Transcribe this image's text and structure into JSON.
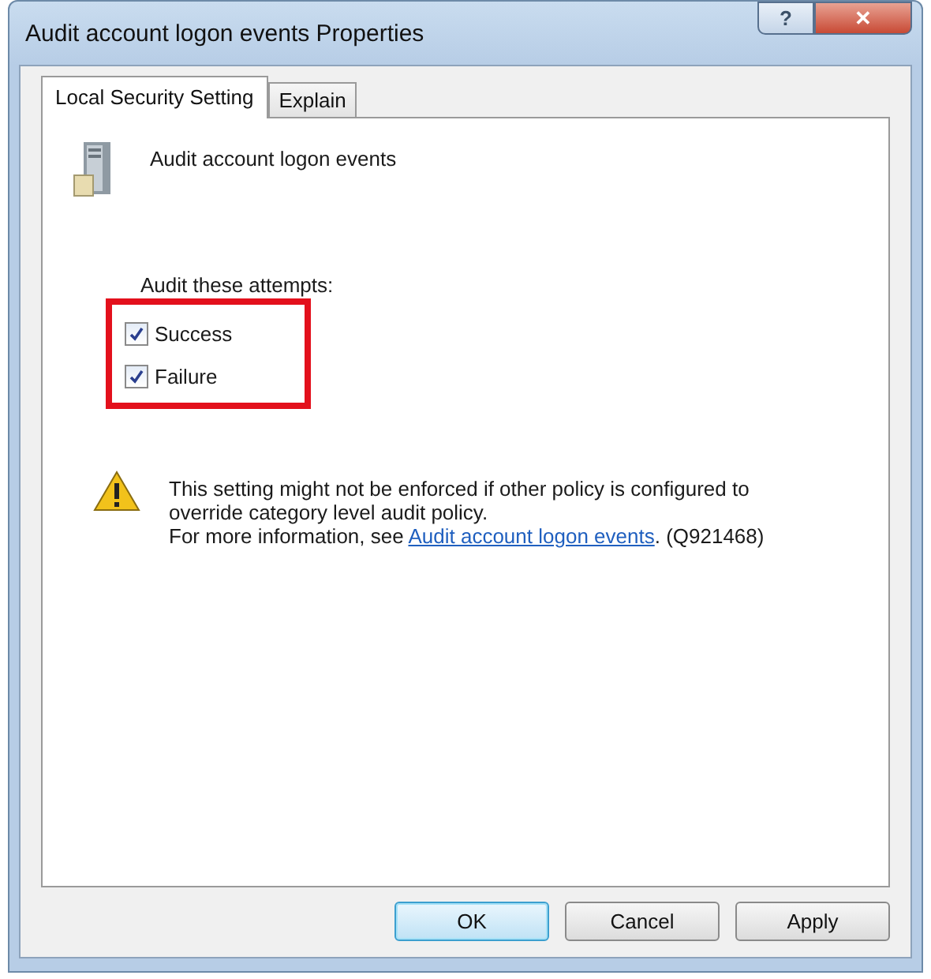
{
  "window": {
    "title": "Audit account logon events Properties",
    "title_buttons": [
      "?",
      "✕"
    ]
  },
  "tabs": [
    {
      "label": "Local Security Setting",
      "selected": true
    },
    {
      "label": "Explain",
      "selected": false
    }
  ],
  "policy": {
    "name": "Audit account logon events"
  },
  "audit": {
    "label": "Audit these attempts:",
    "highlighted": true,
    "options": [
      {
        "label": "Success",
        "checked": true
      },
      {
        "label": "Failure",
        "checked": true
      }
    ]
  },
  "warning": {
    "text": "This setting might not be enforced if other policy is configured to override category level audit policy.",
    "more": "For more information, see ",
    "link": "Audit account logon events",
    "suffix": ". (Q921468)"
  },
  "buttons": [
    {
      "label": "OK",
      "default": true
    },
    {
      "label": "Cancel",
      "default": false
    },
    {
      "label": "Apply",
      "default": false
    }
  ]
}
